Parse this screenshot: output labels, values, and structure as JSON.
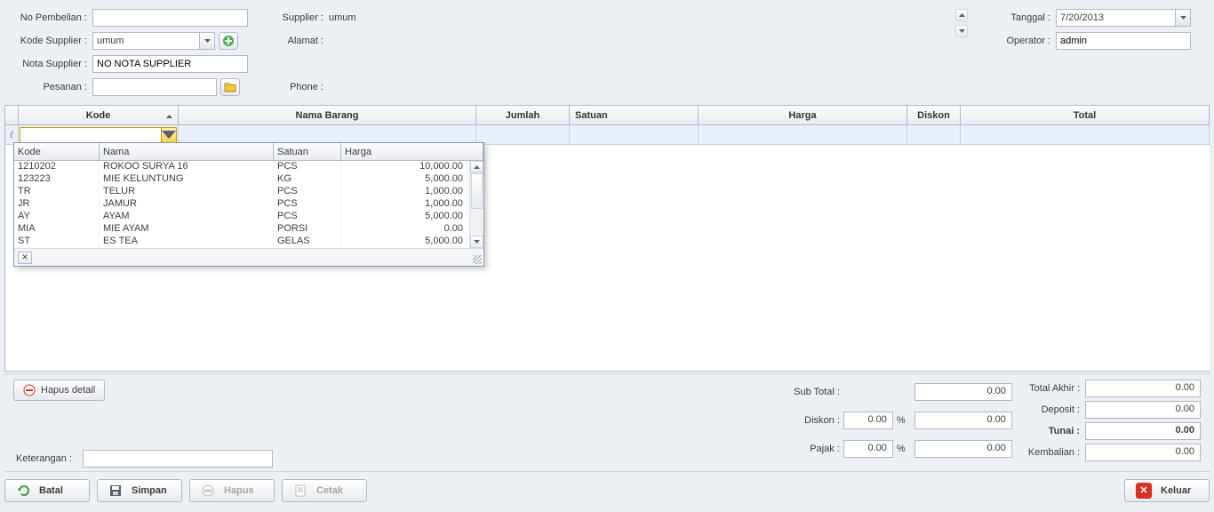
{
  "labels": {
    "no_pembelian": "No Pembelian :",
    "kode_supplier": "Kode Supplier :",
    "nota_supplier": "Nota Supplier :",
    "pesanan": "Pesanan :",
    "supplier": "Supplier :",
    "alamat": "Alamat :",
    "phone": "Phone :",
    "tanggal": "Tanggal :",
    "operator": "Operator :",
    "keterangan": "Keterangan :"
  },
  "header": {
    "no_pembelian": "",
    "kode_supplier": "umum",
    "nota_supplier": "NO NOTA SUPPLIER",
    "pesanan": "",
    "supplier_name": "umum",
    "alamat": "",
    "phone": "",
    "tanggal": "7/20/2013",
    "operator": "admin"
  },
  "grid": {
    "cols": [
      "Kode",
      "Nama Barang",
      "Jumlah",
      "Satuan",
      "Harga",
      "Diskon",
      "Total"
    ],
    "filter_glyph": "ℓ"
  },
  "popup": {
    "cols": [
      "Kode",
      "Nama",
      "Satuan",
      "Harga"
    ],
    "rows": [
      {
        "kode": "1210202",
        "nama": "ROKOO SURYA 16",
        "satuan": "PCS",
        "harga": "10,000.00"
      },
      {
        "kode": "123223",
        "nama": "MIE KELUNTUNG",
        "satuan": "KG",
        "harga": "5,000.00"
      },
      {
        "kode": "TR",
        "nama": "TELUR",
        "satuan": "PCS",
        "harga": "1,000.00"
      },
      {
        "kode": "JR",
        "nama": "JAMUR",
        "satuan": "PCS",
        "harga": "1,000.00"
      },
      {
        "kode": "AY",
        "nama": "AYAM",
        "satuan": "PCS",
        "harga": "5,000.00"
      },
      {
        "kode": "MIA",
        "nama": "MIE AYAM",
        "satuan": "PORSI",
        "harga": "0.00"
      },
      {
        "kode": "ST",
        "nama": "ES TEA",
        "satuan": "GELAS",
        "harga": "5,000.00"
      }
    ],
    "close_glyph": "✕"
  },
  "totals": {
    "left": {
      "subtotal_lbl": "Sub Total :",
      "subtotal": "0.00",
      "diskon_lbl": "Diskon :",
      "diskon_pct": "0.00",
      "diskon_val": "0.00",
      "pajak_lbl": "Pajak :",
      "pajak_pct": "0.00",
      "pajak_val": "0.00",
      "pct": "%"
    },
    "right": {
      "total_akhir_lbl": "Total Akhir :",
      "total_akhir": "0.00",
      "deposit_lbl": "Deposit :",
      "deposit": "0.00",
      "tunai_lbl": "Tunai :",
      "tunai": "0.00",
      "kembalian_lbl": "Kembalian :",
      "kembalian": "0.00"
    }
  },
  "buttons": {
    "hapus_detail": "Hapus detail",
    "batal": "Batal",
    "simpan": "Simpan",
    "hapus": "Hapus",
    "cetak": "Cetak",
    "keluar": "Keluar"
  }
}
